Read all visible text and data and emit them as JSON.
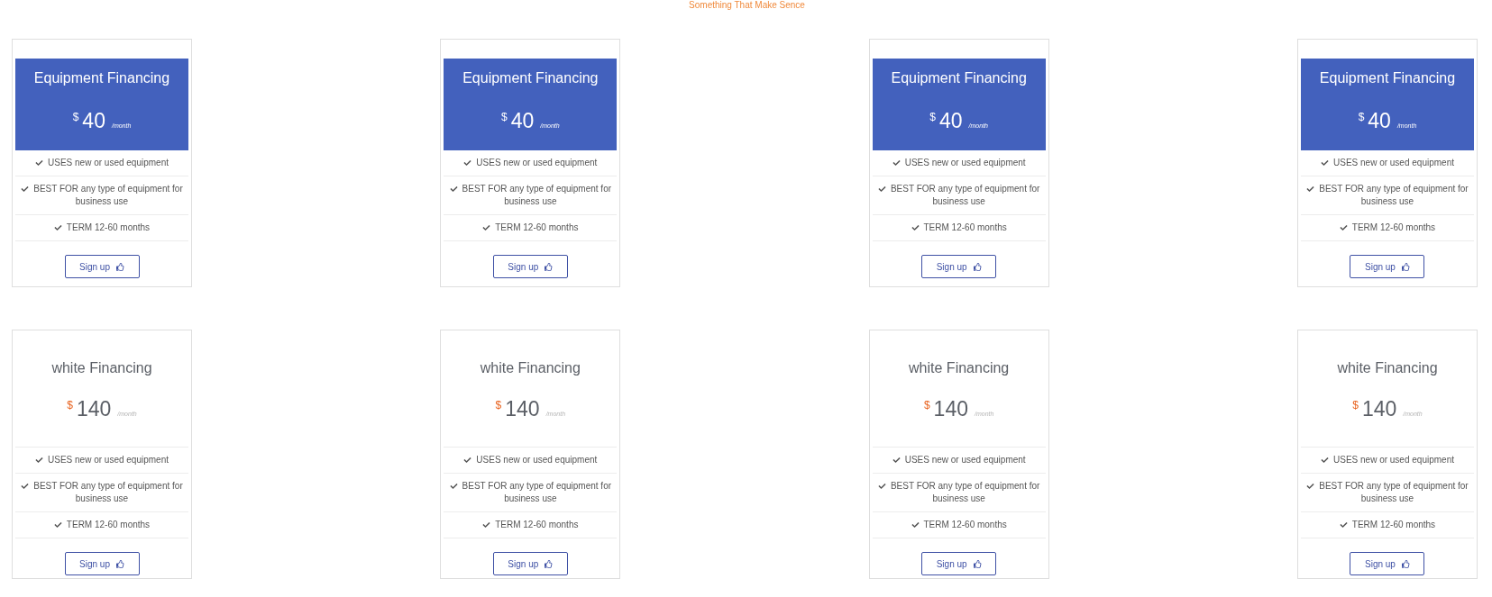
{
  "heading": "Something That Make Sence",
  "plans": [
    {
      "kind": "featured",
      "title": "Equipment Financing",
      "currency": "$",
      "amount": "40",
      "period": "/month",
      "features": [
        "USES new or used equipment",
        "BEST FOR any type of equipment for business use",
        "TERM 12-60 months"
      ],
      "button": "Sign up"
    },
    {
      "kind": "featured",
      "title": "Equipment Financing",
      "currency": "$",
      "amount": "40",
      "period": "/month",
      "features": [
        "USES new or used equipment",
        "BEST FOR any type of equipment for business use",
        "TERM 12-60 months"
      ],
      "button": "Sign up"
    },
    {
      "kind": "featured",
      "title": "Equipment Financing",
      "currency": "$",
      "amount": "40",
      "period": "/month",
      "features": [
        "USES new or used equipment",
        "BEST FOR any type of equipment for business use",
        "TERM 12-60 months"
      ],
      "button": "Sign up"
    },
    {
      "kind": "featured",
      "title": "Equipment Financing",
      "currency": "$",
      "amount": "40",
      "period": "/month",
      "features": [
        "USES new or used equipment",
        "BEST FOR any type of equipment for business use",
        "TERM 12-60 months"
      ],
      "button": "Sign up"
    },
    {
      "kind": "plain",
      "title": "white Financing",
      "currency": "$",
      "amount": "140",
      "period": "/month",
      "features": [
        "USES new or used equipment",
        "BEST FOR any type of equipment for business use",
        "TERM 12-60 months"
      ],
      "button": "Sign up"
    },
    {
      "kind": "plain",
      "title": "white Financing",
      "currency": "$",
      "amount": "140",
      "period": "/month",
      "features": [
        "USES new or used equipment",
        "BEST FOR any type of equipment for business use",
        "TERM 12-60 months"
      ],
      "button": "Sign up"
    },
    {
      "kind": "plain",
      "title": "white Financing",
      "currency": "$",
      "amount": "140",
      "period": "/month",
      "features": [
        "USES new or used equipment",
        "BEST FOR any type of equipment for business use",
        "TERM 12-60 months"
      ],
      "button": "Sign up"
    },
    {
      "kind": "plain",
      "title": "white Financing",
      "currency": "$",
      "amount": "140",
      "period": "/month",
      "features": [
        "USES new or used equipment",
        "BEST FOR any type of equipment for business use",
        "TERM 12-60 months"
      ],
      "button": "Sign up"
    }
  ]
}
